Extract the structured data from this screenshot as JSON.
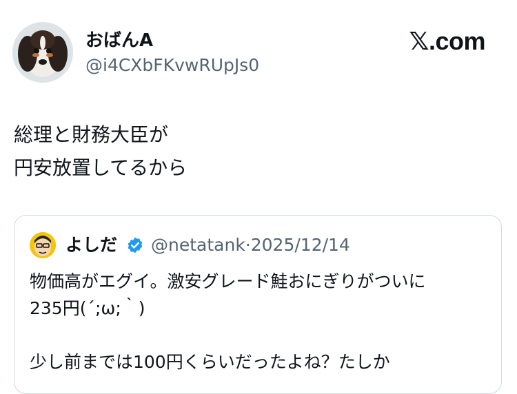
{
  "author": {
    "display_name": "おばんA",
    "handle": "@i4CXbFKvwRUpJs0",
    "avatar_icon": "dog-avatar-icon"
  },
  "source": {
    "label": "𝕏.com",
    "icon": "x-logo-icon"
  },
  "tweet": {
    "text": "総理と財務大臣が\n円安放置してるから"
  },
  "quote": {
    "display_name": "よしだ",
    "verified_icon": "verified-badge-icon",
    "verified_color": "#1d9bf0",
    "handle": "@netatank",
    "separator": "·",
    "date": "2025/12/14",
    "text": "物価高がエグイ。激安グレード鮭おにぎりがついに\n235円(´;ω;｀)\n\n少し前までは100円くらいだったよね？たしか"
  }
}
